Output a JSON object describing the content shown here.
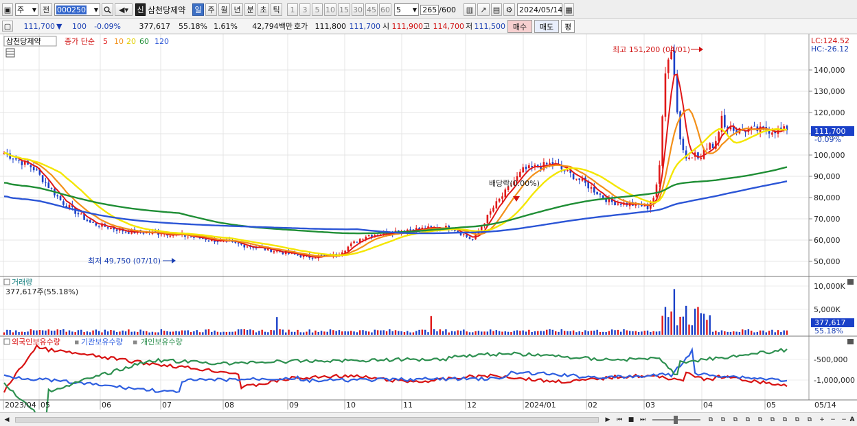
{
  "toolbar": {
    "type_select": "주",
    "prev_label": "전",
    "code": "000250",
    "badge": "신",
    "name": "삼천당제약",
    "periods": [
      "일",
      "주",
      "월",
      "년",
      "분",
      "초",
      "틱"
    ],
    "active_period": "일",
    "intervals": [
      "1",
      "3",
      "5",
      "10",
      "15",
      "30",
      "45",
      "60"
    ],
    "interval_value": "5",
    "count": "265",
    "count_max": "/600",
    "date": "2024/05/14"
  },
  "quote": {
    "price": "111,700",
    "arrow": "▼",
    "change": "100",
    "change_pct": "-0.09%",
    "volume": "377,617",
    "volume_ratio": "55.18%",
    "turnover": "1.61%",
    "value": "42,794백만",
    "bid_label": "호가",
    "bid1": "111,800",
    "bid2": "111,700",
    "open_label": "시",
    "open": "111,900",
    "high_label": "고",
    "high": "114,700",
    "low_label": "저",
    "low": "111,500",
    "buy_label": "매수",
    "sell_label": "매도",
    "even_label": "평"
  },
  "price_panel": {
    "stock_label": "삼천당제약",
    "ma_label": "종가 단순",
    "ma_periods": [
      "5",
      "10",
      "20",
      "60",
      "120"
    ],
    "lc": "LC:124.52",
    "hc": "HC:-26.12",
    "current_tag": "111,700",
    "current_pct": "-0.09%",
    "high_note": "최고 151,200 (04/01)",
    "low_note": "최저 49,750 (07/10)",
    "dividend_note": "배당락(0.00%)",
    "axis_labels": [
      "140,000",
      "130,000",
      "120,000",
      "110,000",
      "100,000",
      "90,000",
      "80,000",
      "70,000",
      "60,000",
      "50,000"
    ]
  },
  "volume_panel": {
    "title": "거래량",
    "current": "377,617주(55.18%)",
    "axis_labels": [
      "10,000K",
      "5,000K"
    ],
    "current_tag": "377,617",
    "current_pct": "55.18%"
  },
  "holdings_panel": {
    "legend": [
      "외국인보유수량",
      "기관보유수량",
      "개인보유수량"
    ],
    "axis_labels": [
      "-500,000",
      "-1,000,000"
    ]
  },
  "x_axis": {
    "labels": [
      "2023/04",
      "05",
      "06",
      "07",
      "08",
      "09",
      "10",
      "11",
      "12",
      "2024/01",
      "02",
      "03",
      "04",
      "05"
    ],
    "end_label": "05/14"
  },
  "colors": {
    "ma5": "#e01818",
    "ma10": "#f39019",
    "ma20": "#f4e600",
    "ma60": "#1f8e35",
    "ma120": "#2b55d6",
    "up": "#e01818",
    "down": "#1a40c8",
    "foreign": "#d81212",
    "institution": "#2f5fe0",
    "individual": "#2e9050"
  }
}
